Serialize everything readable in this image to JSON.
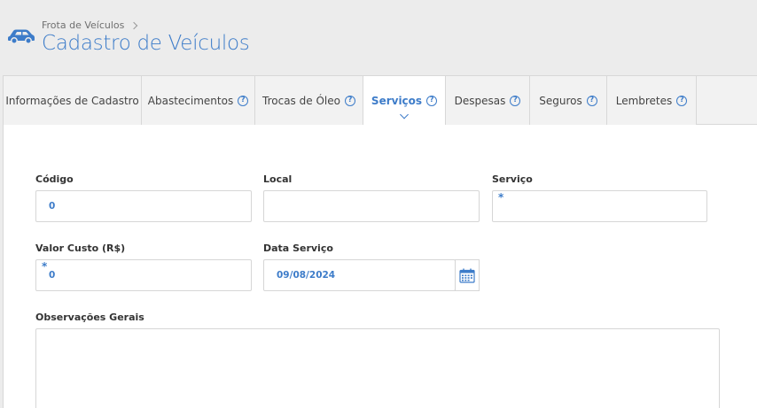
{
  "header": {
    "breadcrumb": "Frota de Veículos",
    "title": "Cadastro de Veículos"
  },
  "tabs": [
    {
      "label": "Informações de Cadastro",
      "help": false
    },
    {
      "label": "Abastecimentos",
      "help": true
    },
    {
      "label": "Trocas de Óleo",
      "help": true
    },
    {
      "label": "Serviços",
      "help": true,
      "active": true
    },
    {
      "label": "Despesas",
      "help": true
    },
    {
      "label": "Seguros",
      "help": true
    },
    {
      "label": "Lembretes",
      "help": true
    }
  ],
  "form": {
    "codigo": {
      "label": "Código",
      "value": "0"
    },
    "local": {
      "label": "Local",
      "value": ""
    },
    "servico": {
      "label": "Serviço",
      "value": "",
      "required_mark": "*"
    },
    "valor_custo": {
      "label": "Valor Custo (R$)",
      "value": "0",
      "required_mark": "*"
    },
    "data_servico": {
      "label": "Data Serviço",
      "value": "09/08/2024"
    },
    "observacoes": {
      "label": "Observações Gerais",
      "value": ""
    }
  },
  "help_glyph": "?",
  "colors": {
    "accent": "#3d7cc9",
    "background": "#ececec"
  }
}
